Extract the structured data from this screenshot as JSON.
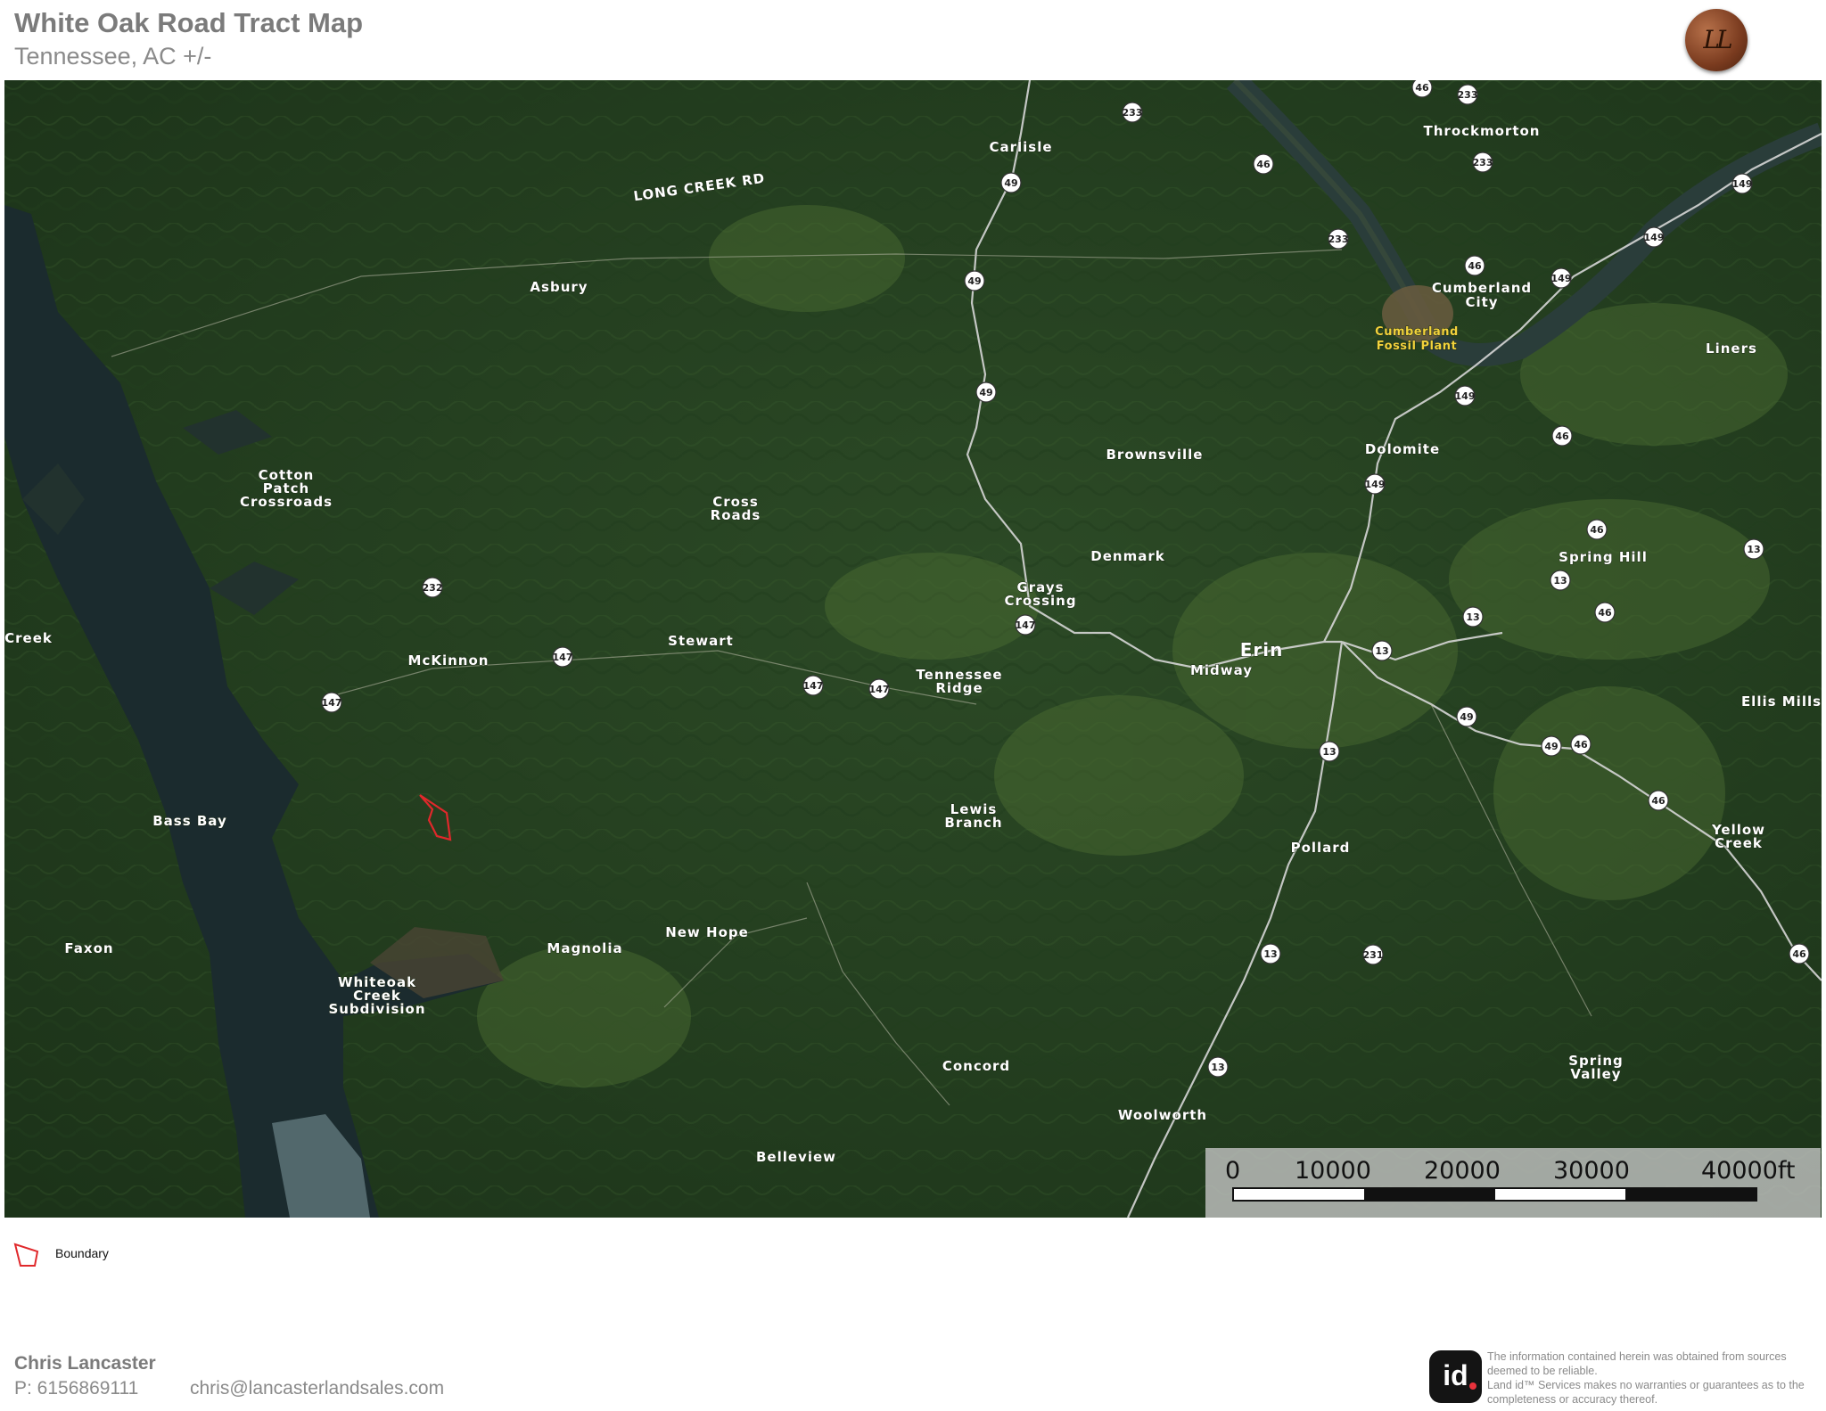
{
  "header": {
    "title": "White Oak Road Tract Map",
    "subtitle": "Tennessee,  AC +/-",
    "logo_text": "LL"
  },
  "map": {
    "places": [
      {
        "id": "carlisle",
        "label": "Carlisle"
      },
      {
        "id": "throckmorton",
        "label": "Throckmorton"
      },
      {
        "id": "asbury",
        "label": "Asbury"
      },
      {
        "id": "cumberland-city-1",
        "label": "Cumberland"
      },
      {
        "id": "cumberland-city-2",
        "label": "City"
      },
      {
        "id": "liners",
        "label": "Liners"
      },
      {
        "id": "brownsville",
        "label": "Brownsville"
      },
      {
        "id": "dolomite",
        "label": "Dolomite"
      },
      {
        "id": "cotton-patch-1",
        "label": "Cotton"
      },
      {
        "id": "cotton-patch-2",
        "label": "Patch"
      },
      {
        "id": "cotton-patch-3",
        "label": "Crossroads"
      },
      {
        "id": "cross-roads-1",
        "label": "Cross"
      },
      {
        "id": "cross-roads-2",
        "label": "Roads"
      },
      {
        "id": "denmark",
        "label": "Denmark"
      },
      {
        "id": "spring-hill",
        "label": "Spring Hill"
      },
      {
        "id": "grays-crossing-1",
        "label": "Grays"
      },
      {
        "id": "grays-crossing-2",
        "label": "Crossing"
      },
      {
        "id": "creek",
        "label": "Creek"
      },
      {
        "id": "stewart",
        "label": "Stewart"
      },
      {
        "id": "mckinnon",
        "label": "McKinnon"
      },
      {
        "id": "tennessee-ridge-1",
        "label": "Tennessee"
      },
      {
        "id": "tennessee-ridge-2",
        "label": "Ridge"
      },
      {
        "id": "erin",
        "label": "Erin"
      },
      {
        "id": "midway",
        "label": "Midway"
      },
      {
        "id": "ellis-mills",
        "label": "Ellis Mills"
      },
      {
        "id": "lewis-branch-1",
        "label": "Lewis"
      },
      {
        "id": "lewis-branch-2",
        "label": "Branch"
      },
      {
        "id": "bass-bay",
        "label": "Bass Bay"
      },
      {
        "id": "yellow-creek-1",
        "label": "Yellow"
      },
      {
        "id": "yellow-creek-2",
        "label": "Creek"
      },
      {
        "id": "pollard",
        "label": "Pollard"
      },
      {
        "id": "new-hope",
        "label": "New Hope"
      },
      {
        "id": "faxon",
        "label": "Faxon"
      },
      {
        "id": "magnolia",
        "label": "Magnolia"
      },
      {
        "id": "whiteoak-1",
        "label": "Whiteoak"
      },
      {
        "id": "whiteoak-2",
        "label": "Creek"
      },
      {
        "id": "whiteoak-3",
        "label": "Subdivision"
      },
      {
        "id": "concord",
        "label": "Concord"
      },
      {
        "id": "spring-valley-1",
        "label": "Spring"
      },
      {
        "id": "spring-valley-2",
        "label": "Valley"
      },
      {
        "id": "woolworth",
        "label": "Woolworth"
      },
      {
        "id": "belleview",
        "label": "Belleview"
      }
    ],
    "fossil_plant": [
      "Cumberland",
      "Fossil Plant"
    ],
    "road_label": "LONG CREEK RD",
    "shields": [
      "46",
      "233",
      "233",
      "46",
      "233",
      "233",
      "46",
      "149",
      "149",
      "149",
      "149",
      "149",
      "46",
      "46",
      "13",
      "13",
      "46",
      "13",
      "13",
      "49",
      "49",
      "46",
      "46",
      "46",
      "13",
      "231",
      "13",
      "13",
      "49",
      "49",
      "49",
      "232",
      "147",
      "147",
      "147",
      "147",
      "147"
    ]
  },
  "scale": {
    "labels": [
      "0",
      "10000",
      "20000",
      "30000",
      "40000ft"
    ]
  },
  "legend": {
    "boundary_label": "Boundary",
    "boundary_color": "#e0282b"
  },
  "agent": {
    "name": "Chris Lancaster",
    "phone": "P: 6156869111",
    "email": "chris@lancasterlandsales.com"
  },
  "footer": {
    "id_logo": "id",
    "disclaimer": "The information contained herein was obtained from sources deemed to be reliable.\n Land id™ Services makes no warranties or guarantees as to the completeness or accuracy thereof."
  }
}
